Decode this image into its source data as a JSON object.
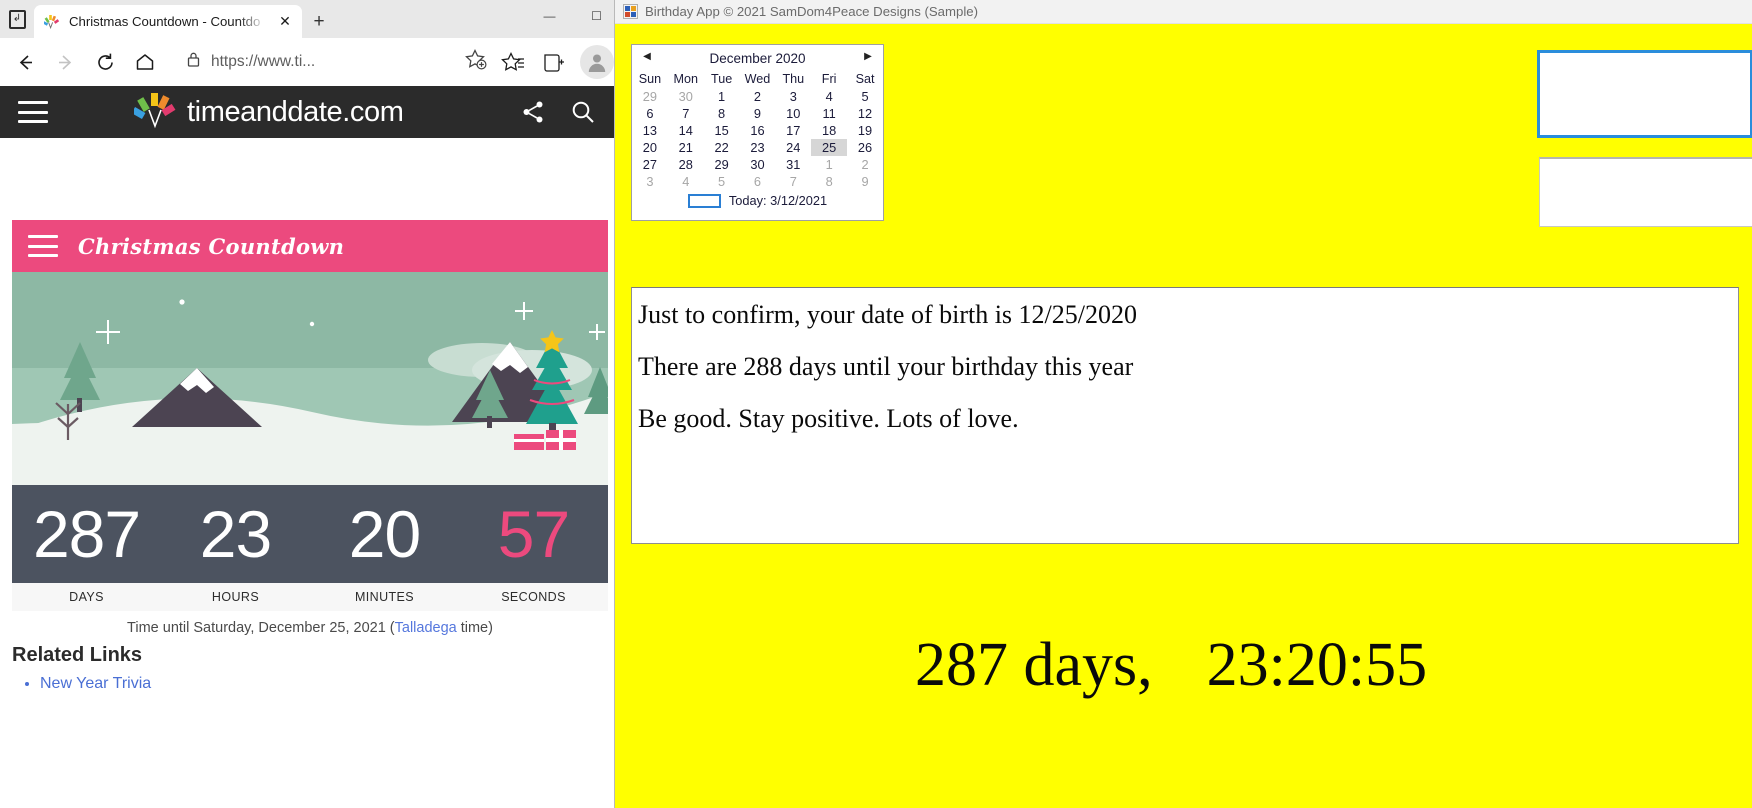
{
  "browser": {
    "tab": {
      "title": "Christmas Countdown - Countdo",
      "favicon_name": "timeanddate-favicon",
      "close_label": "✕",
      "newtab_label": "+"
    },
    "window_controls": {
      "minimize": "—",
      "maximize": "☐"
    },
    "toolbar": {
      "back": "←",
      "forward": "→",
      "reload": "↻",
      "home": "⌂",
      "lock_icon": "lock-icon",
      "url": "https://www.ti...",
      "favorite": "☆",
      "collections": "☆",
      "split_screen": "⊞",
      "profile": "profile-avatar"
    }
  },
  "site": {
    "header": {
      "brand": "timeanddate.com",
      "menu_icon": "hamburger-icon",
      "share_icon": "share-icon",
      "search_icon": "search-icon"
    },
    "countdown_card": {
      "title": "Christmas Countdown",
      "menu_icon": "hamburger-icon",
      "units": [
        {
          "value": "287",
          "label": "DAYS",
          "accent": false
        },
        {
          "value": "23",
          "label": "HOURS",
          "accent": false
        },
        {
          "value": "20",
          "label": "MINUTES",
          "accent": false
        },
        {
          "value": "57",
          "label": "SECONDS",
          "accent": true
        }
      ],
      "caption_prefix": "Time until Saturday, December 25, 2021 (",
      "caption_link": "Talladega",
      "caption_suffix": " time)",
      "accent_color": "#ec4a7e",
      "counter_bg": "#4c5360"
    },
    "related": {
      "heading": "Related Links",
      "links": [
        "New Year Trivia"
      ]
    }
  },
  "birthday_app": {
    "title": "Birthday App © 2021 SamDom4Peace Designs (Sample)",
    "icon_name": "app-window-icon",
    "background_color": "#ffff00",
    "calendar": {
      "prev_label": "◀",
      "next_label": "▶",
      "month_label": "December 2020",
      "weekdays": [
        "Sun",
        "Mon",
        "Tue",
        "Wed",
        "Thu",
        "Fri",
        "Sat"
      ],
      "weeks": [
        [
          {
            "d": "29",
            "muted": true
          },
          {
            "d": "30",
            "muted": true
          },
          {
            "d": "1"
          },
          {
            "d": "2"
          },
          {
            "d": "3"
          },
          {
            "d": "4"
          },
          {
            "d": "5"
          }
        ],
        [
          {
            "d": "6"
          },
          {
            "d": "7"
          },
          {
            "d": "8"
          },
          {
            "d": "9"
          },
          {
            "d": "10"
          },
          {
            "d": "11"
          },
          {
            "d": "12"
          }
        ],
        [
          {
            "d": "13"
          },
          {
            "d": "14"
          },
          {
            "d": "15"
          },
          {
            "d": "16"
          },
          {
            "d": "17"
          },
          {
            "d": "18"
          },
          {
            "d": "19"
          }
        ],
        [
          {
            "d": "20"
          },
          {
            "d": "21"
          },
          {
            "d": "22"
          },
          {
            "d": "23"
          },
          {
            "d": "24"
          },
          {
            "d": "25",
            "selected": true
          },
          {
            "d": "26"
          }
        ],
        [
          {
            "d": "27"
          },
          {
            "d": "28"
          },
          {
            "d": "29"
          },
          {
            "d": "30"
          },
          {
            "d": "31"
          },
          {
            "d": "1",
            "muted": true
          },
          {
            "d": "2",
            "muted": true
          }
        ],
        [
          {
            "d": "3",
            "muted": true
          },
          {
            "d": "4",
            "muted": true
          },
          {
            "d": "5",
            "muted": true
          },
          {
            "d": "6",
            "muted": true
          },
          {
            "d": "7",
            "muted": true
          },
          {
            "d": "8",
            "muted": true
          },
          {
            "d": "9",
            "muted": true
          }
        ]
      ],
      "today_label": "Today: 3/12/2021",
      "selected_date": "25"
    },
    "message_lines": [
      "Just to confirm, your date of birth is 12/25/2020",
      "There are 288 days until your birthday this year",
      "Be good. Stay positive. Lots of love."
    ],
    "side_fields": [
      {
        "name": "focused-textbox",
        "value": "",
        "focused": true
      },
      {
        "name": "secondary-textbox",
        "value": "",
        "focused": false
      }
    ],
    "live_countdown": {
      "days_text": "287 days,",
      "time_text": "23:20:55"
    }
  }
}
